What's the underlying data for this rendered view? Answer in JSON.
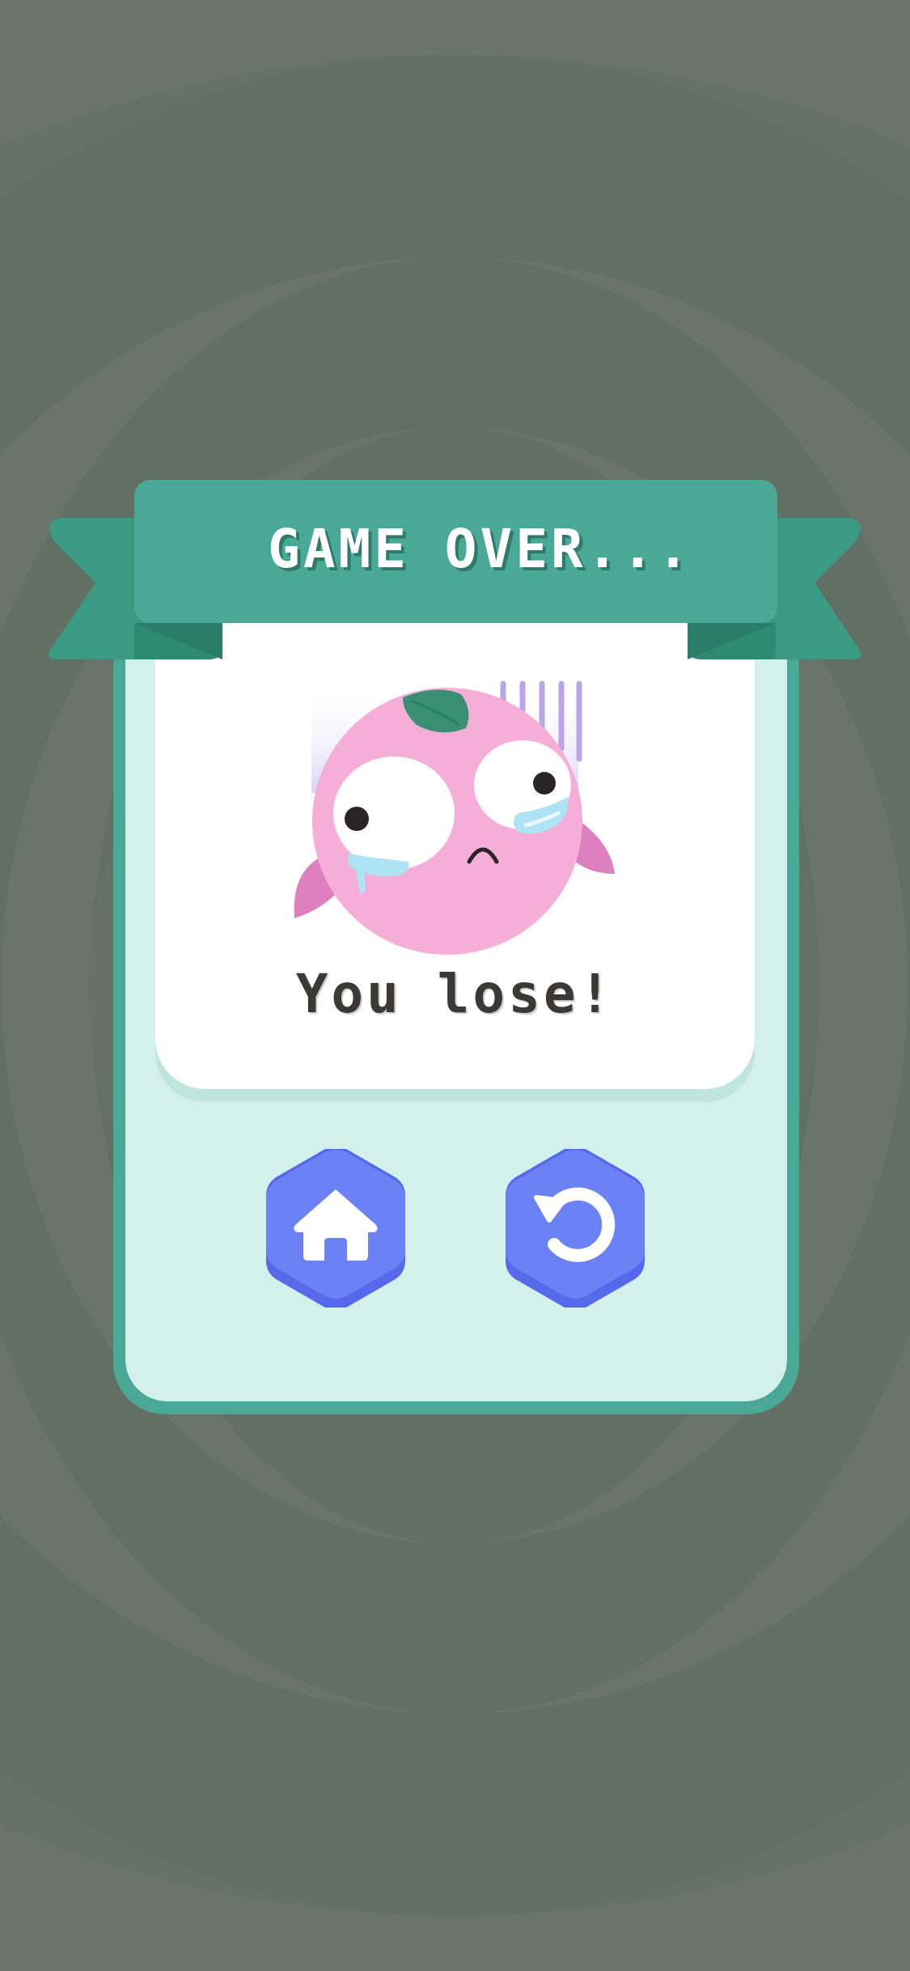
{
  "banner": {
    "title": "GAME OVER..."
  },
  "result": {
    "message": "You lose!"
  },
  "buttons": [
    {
      "name": "home-button",
      "icon": "home-icon"
    },
    {
      "name": "retry-button",
      "icon": "retry-icon"
    }
  ],
  "colors": {
    "background": "#6a746b",
    "panel_border": "#4aa896",
    "panel_fill": "#d3f0ea",
    "banner": "#4aa896",
    "banner_dark": "#2f8a73",
    "card": "#ffffff",
    "button": "#6b82f6",
    "character_pink": "#f4aed8",
    "text_dark": "#3b3936"
  }
}
